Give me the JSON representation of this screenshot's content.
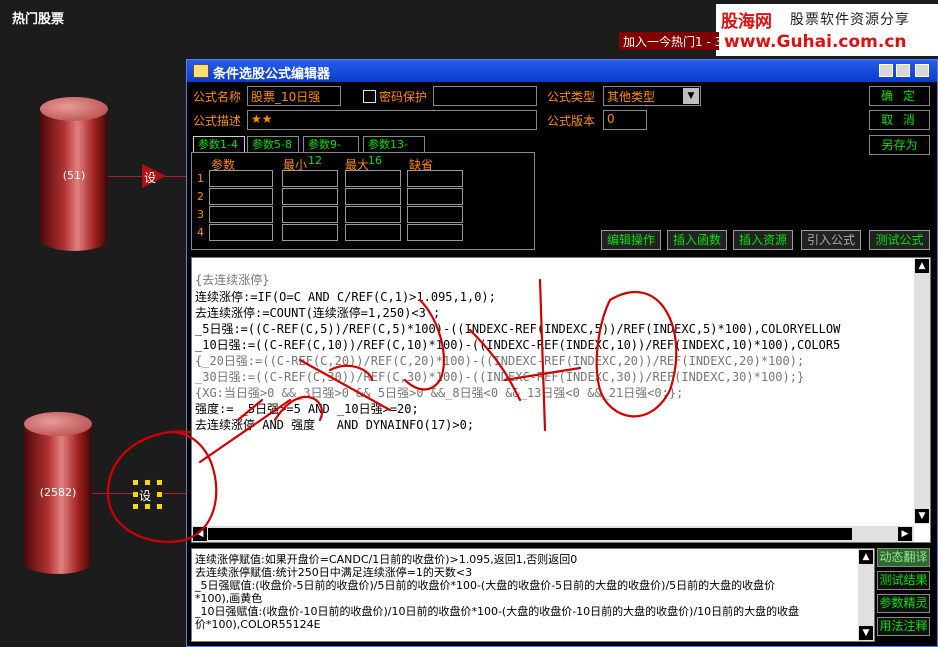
{
  "page": {
    "title": "热门股票"
  },
  "chart": {
    "node1_label": "(51)",
    "node2_label": "(2582)",
    "set_label": "设",
    "set_label2": "设"
  },
  "logo": {
    "cn": "股海网",
    "slogan": "股票软件资源分享",
    "url": "www.Guhai.com.cn"
  },
  "popup_tab": "加入一今热门1 - 3",
  "dialog": {
    "title": "条件选股公式编辑器",
    "labels": {
      "name": "公式名称",
      "password": "密码保护",
      "type": "公式类型",
      "desc": "公式描述",
      "version": "公式版本"
    },
    "values": {
      "name": "股票_10日强",
      "type": "其他类型",
      "desc": "★★",
      "version": "0"
    },
    "buttons": {
      "ok": "确 定",
      "cancel": "取 消",
      "saveas": "另存为"
    },
    "tabs": [
      "参数1-4",
      "参数5-8",
      "参数9-12",
      "参数13-16"
    ],
    "param_headers": [
      "参数",
      "最小",
      "最大",
      "缺省"
    ],
    "param_rows": [
      "1",
      "2",
      "3",
      "4"
    ],
    "actions": [
      "编辑操作",
      "插入函数",
      "插入资源",
      "引入公式",
      "测试公式"
    ],
    "code_lines": [
      "{去连续涨停}",
      "连续涨停:=IF(O=C AND C/REF(C,1)>1.095,1,0);",
      "去连续涨停:=COUNT(连续涨停=1,250)<3 ;",
      "_5日强:=((C-REF(C,5))/REF(C,5)*100)-((INDEXC-REF(INDEXC,5))/REF(INDEXC,5)*100),COLORYELLOW",
      "_10日强:=((C-REF(C,10))/REF(C,10)*100)-((INDEXC-REF(INDEXC,10))/REF(INDEXC,10)*100),COLOR5",
      "{_20日强:=((C-REF(C,20))/REF(C,20)*100)-((INDEXC-REF(INDEXC,20))/REF(INDEXC,20)*100);",
      "_30日强:=((C-REF(C,30))/REF(C,30)*100)-((INDEXC-REF(INDEXC,30))/REF(INDEXC,30)*100);}",
      "{XG:当日强>0 &&_3日强>0 && 5日强>0 &&_8日强<0 &&_13日强<0 &&_21日强<0;};",
      "强度:= _5日强>=5 AND _10日强>=20;",
      "去连续涨停 AND 强度   AND DYNAINFO(17)>0;"
    ],
    "notes": [
      "连续涨停赋值:如果开盘价=CANDC/1日前的收盘价)>1.095,返回1,否则返回0",
      "去连续涨停赋值:统计250日中满足连续涨停=1的天数<3",
      "_5日强赋值:(收盘价-5日前的收盘价)/5日前的收盘价*100-(大盘的收盘价-5日前的大盘的收盘价)/5日前的大盘的收盘价",
      "*100),画黄色",
      "_10日强赋值:(收盘价-10日前的收盘价)/10日前的收盘价*100-(大盘的收盘价-10日前的大盘的收盘价)/10日前的大盘的收盘",
      "价*100),COLOR55124E"
    ],
    "side_buttons": [
      "动态翻译",
      "测试结果",
      "参数精灵",
      "用法注释"
    ]
  }
}
